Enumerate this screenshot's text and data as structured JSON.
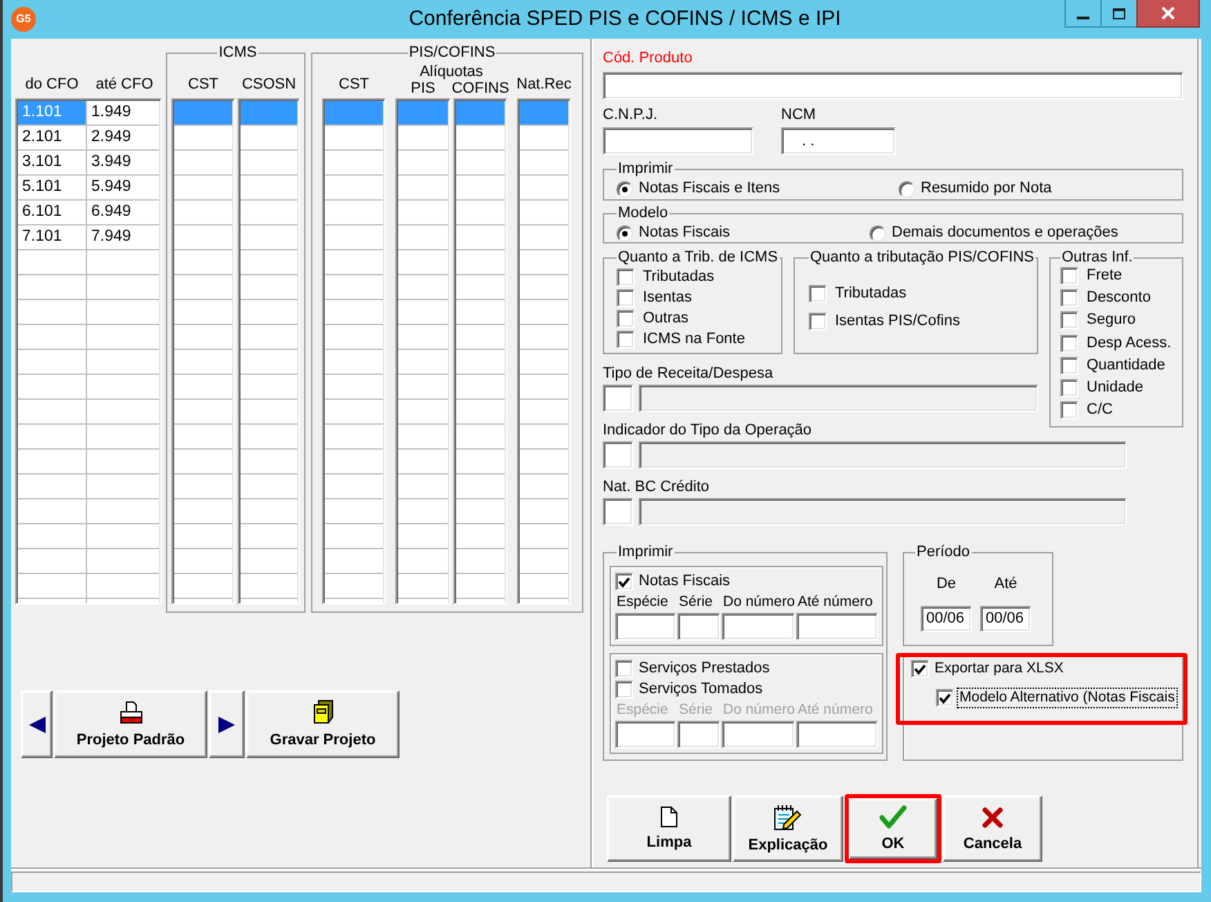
{
  "window": {
    "logo_text": "G5",
    "title": "Conferência SPED PIS e COFINS / ICMS e IPI"
  },
  "cfo_table": {
    "columns": [
      "do CFO",
      "até CFO"
    ],
    "rows": [
      {
        "cells": [
          {
            "text": "1.101",
            "selected": true
          },
          {
            "text": "1.949",
            "selected": false
          }
        ]
      },
      {
        "cells": [
          {
            "text": "2.101",
            "selected": false
          },
          {
            "text": "2.949",
            "selected": false
          }
        ]
      },
      {
        "cells": [
          {
            "text": "3.101",
            "selected": false
          },
          {
            "text": "3.949",
            "selected": false
          }
        ]
      },
      {
        "cells": [
          {
            "text": "5.101",
            "selected": false
          },
          {
            "text": "5.949",
            "selected": false
          }
        ]
      },
      {
        "cells": [
          {
            "text": "6.101",
            "selected": false
          },
          {
            "text": "6.949",
            "selected": false
          }
        ]
      },
      {
        "cells": [
          {
            "text": "7.101",
            "selected": false
          },
          {
            "text": "7.949",
            "selected": false
          }
        ]
      }
    ]
  },
  "icms": {
    "title": "ICMS",
    "columns": [
      {
        "header": "CST",
        "first_cell_selected": true
      },
      {
        "header": "CSOSN",
        "first_cell_selected": true
      }
    ]
  },
  "pis_cofins": {
    "title": "PIS/COFINS",
    "rates_label": "Alíquotas",
    "columns": [
      {
        "header": "CST",
        "kind": "plain",
        "first_cell_selected": true
      },
      {
        "header": "PIS",
        "kind": "rate",
        "first_cell_selected": true
      },
      {
        "header": "COFINS",
        "kind": "rate",
        "first_cell_selected": true
      },
      {
        "header": "Nat.Rec",
        "kind": "plain",
        "first_cell_selected": true
      }
    ]
  },
  "project_buttons": [
    {
      "kind": "prev"
    },
    {
      "kind": "default",
      "label": "Projeto Padrão"
    },
    {
      "kind": "next"
    },
    {
      "kind": "save",
      "label": "Gravar Projeto"
    }
  ],
  "product": {
    "label": "Cód. Produto",
    "required": true
  },
  "cnpj": {
    "label": "C.N.P.J.",
    "required": false
  },
  "ncm": {
    "label": "NCM",
    "required": false,
    "value": ". ."
  },
  "print_mode": {
    "title": "Imprimir",
    "options": [
      {
        "label": "Notas Fiscais e Itens",
        "selected": true
      },
      {
        "label": "Resumido por Nota",
        "selected": false
      }
    ]
  },
  "model": {
    "title": "Modelo",
    "options": [
      {
        "label": "Notas Fiscais",
        "selected": true
      },
      {
        "label": "Demais documentos e operações",
        "selected": false
      }
    ]
  },
  "icms_filter": {
    "title": "Quanto a Trib. de ICMS",
    "items": [
      {
        "label": "Tributadas",
        "checked": false
      },
      {
        "label": "Isentas",
        "checked": false
      },
      {
        "label": "Outras",
        "checked": false
      },
      {
        "label": "ICMS na Fonte",
        "checked": false
      }
    ]
  },
  "pis_filter": {
    "title": "Quanto a tributação PIS/COFINS",
    "items": [
      {
        "label": "Tributadas",
        "checked": false
      },
      {
        "label": "Isentas PIS/Cofins",
        "checked": false
      }
    ]
  },
  "other_info": {
    "title": "Outras Inf.",
    "items": [
      {
        "label": "Frete",
        "checked": false
      },
      {
        "label": "Desconto",
        "checked": false
      },
      {
        "label": "Seguro",
        "checked": false
      },
      {
        "label": "Desp Acess.",
        "checked": false
      },
      {
        "label": "Quantidade",
        "checked": false
      },
      {
        "label": "Unidade",
        "checked": false
      },
      {
        "label": "C/C",
        "checked": false
      }
    ]
  },
  "lookups": [
    {
      "label": "Tipo de Receita/Despesa"
    },
    {
      "label": "Indicador do Tipo da Operação"
    },
    {
      "label": "Nat. BC Crédito"
    }
  ],
  "print_docs": {
    "title": "Imprimir",
    "sections": [
      {
        "items": [
          {
            "label": "Notas Fiscais",
            "checked": true
          }
        ],
        "columns": [
          "Espécie",
          "Série",
          "Do número",
          "Até número"
        ],
        "disabled": false
      },
      {
        "items": [
          {
            "label": "Serviços Prestados",
            "checked": false
          },
          {
            "label": "Serviços Tomados",
            "checked": false
          }
        ],
        "columns": [
          "Espécie",
          "Série",
          "Do número",
          "Até número"
        ],
        "disabled": true
      }
    ]
  },
  "period": {
    "title": "Período",
    "fields": [
      {
        "label": "De",
        "value": "00/06"
      },
      {
        "label": "Até",
        "value": "00/06"
      }
    ]
  },
  "export": {
    "highlighted": true,
    "items": [
      {
        "label": "Exportar para XLSX",
        "checked": true,
        "children": [
          {
            "label": "Modelo Alternativo (Notas Fiscais",
            "checked": true,
            "focused": true
          }
        ]
      }
    ]
  },
  "actions": [
    {
      "kind": "clear",
      "label": "Limpa",
      "highlighted": false
    },
    {
      "kind": "explain",
      "label": "Explicação",
      "highlighted": false
    },
    {
      "kind": "ok",
      "label": "OK",
      "highlighted": true
    },
    {
      "kind": "cancel",
      "label": "Cancela",
      "highlighted": false
    }
  ]
}
